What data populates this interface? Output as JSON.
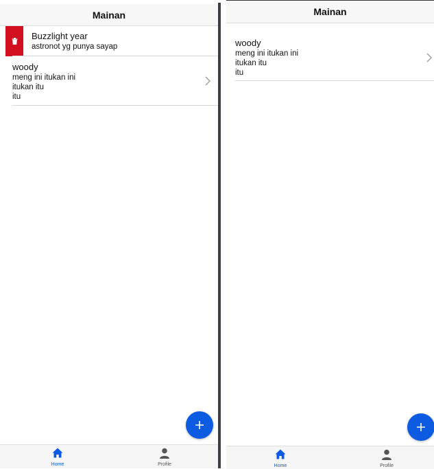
{
  "header": {
    "title": "Mainan"
  },
  "left": {
    "swiped_item": {
      "title": "Buzzlight year",
      "subtitle": "astronot yg punya sayap"
    },
    "item": {
      "title": "woody",
      "subtitle": "meng ini itukan ini\nitukan itu\nitu"
    }
  },
  "right": {
    "item": {
      "title": "woody",
      "subtitle": "meng ini itukan ini\nitukan itu\nitu"
    }
  },
  "tabs": {
    "home": "Home",
    "profile": "Profile"
  },
  "icons": {
    "delete": "trash-icon",
    "add": "plus-icon",
    "chevron": "chevron-right-icon",
    "home": "home-icon",
    "profile": "person-icon"
  },
  "colors": {
    "accent": "#0d5be1",
    "danger": "#d10f1e"
  }
}
